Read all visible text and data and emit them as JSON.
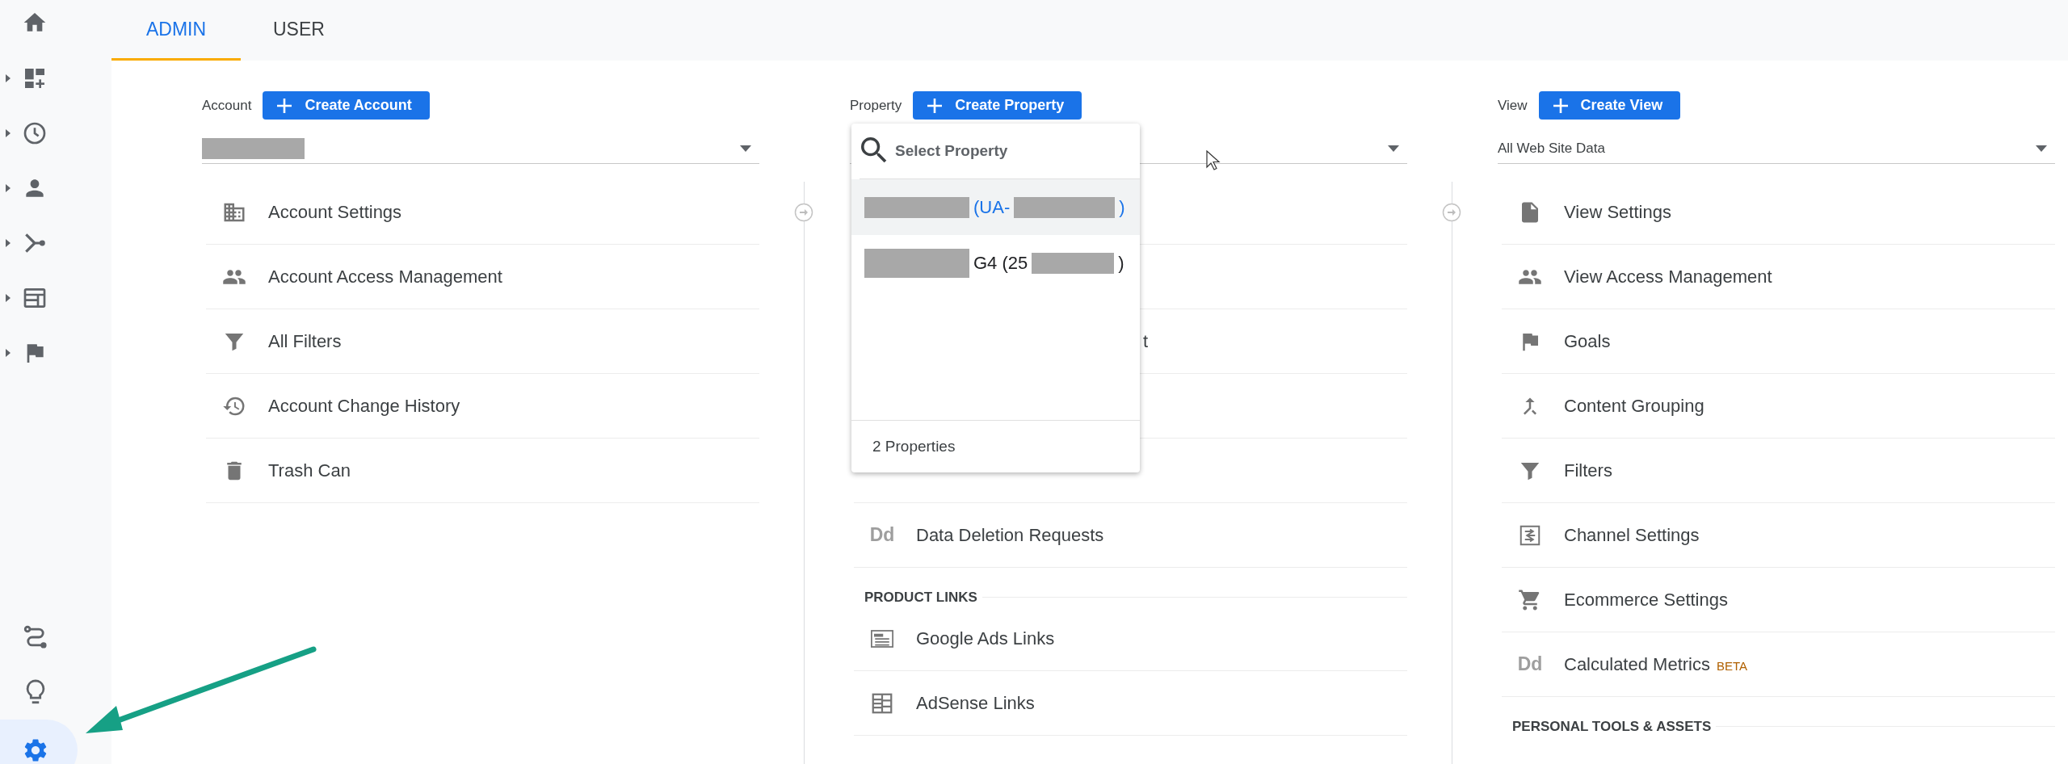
{
  "sidebar": {
    "items": [
      {
        "kind": "home",
        "expandable": false,
        "selected": false
      },
      {
        "kind": "dashboard",
        "expandable": true,
        "selected": false
      },
      {
        "kind": "clock",
        "expandable": true,
        "selected": false
      },
      {
        "kind": "person",
        "expandable": true,
        "selected": false
      },
      {
        "kind": "acquisition",
        "expandable": true,
        "selected": false
      },
      {
        "kind": "behavior",
        "expandable": true,
        "selected": false
      },
      {
        "kind": "flag",
        "expandable": true,
        "selected": false
      }
    ],
    "bottom_items": [
      {
        "kind": "route",
        "selected": false
      },
      {
        "kind": "bulb",
        "selected": false
      },
      {
        "kind": "gear",
        "selected": true
      }
    ]
  },
  "tabs": [
    {
      "label": "ADMIN",
      "selected": true
    },
    {
      "label": "USER",
      "selected": false
    }
  ],
  "columns": [
    {
      "label": "Account",
      "button": "Create Account",
      "selector": {
        "redacted": true
      },
      "items": [
        {
          "kind": "building",
          "label": "Account Settings"
        },
        {
          "kind": "people",
          "label": "Account Access Management"
        },
        {
          "kind": "filter",
          "label": "All Filters"
        },
        {
          "kind": "history",
          "label": "Account Change History"
        },
        {
          "kind": "trash",
          "label": "Trash Can"
        }
      ]
    },
    {
      "label": "Property",
      "button": "Create Property",
      "selector": {
        "redacted": false
      },
      "dropdown": {
        "placeholder": "Select Property",
        "footer": "2 Properties",
        "options": [
          {
            "selected": true,
            "parts": [
              {
                "kind": "redacted"
              },
              {
                "kind": "text",
                "text": "(UA-"
              },
              {
                "kind": "redacted"
              },
              {
                "kind": "text",
                "text": ")"
              }
            ]
          },
          {
            "selected": false,
            "parts": [
              {
                "kind": "redacted"
              },
              {
                "kind": "text",
                "text": "G4 (25"
              },
              {
                "kind": "redacted"
              },
              {
                "kind": "text",
                "text": ")"
              }
            ]
          }
        ]
      },
      "items": [
        {
          "kind": "covered"
        },
        {
          "kind": "covered"
        },
        {
          "kind": "covered",
          "fragment": "t"
        },
        {
          "kind": "covered"
        },
        {
          "kind": "covered"
        },
        {
          "kind": "letters",
          "icon_text": "Dd",
          "label": "Data Deletion Requests"
        }
      ],
      "section": {
        "title": "PRODUCT LINKS",
        "items": [
          {
            "kind": "ads",
            "label": "Google Ads Links"
          },
          {
            "kind": "adsense",
            "label": "AdSense Links"
          }
        ]
      }
    },
    {
      "label": "View",
      "button": "Create View",
      "selector": {
        "redacted": false,
        "value": "All Web Site Data"
      },
      "items": [
        {
          "kind": "doc",
          "label": "View Settings"
        },
        {
          "kind": "people",
          "label": "View Access Management"
        },
        {
          "kind": "flag",
          "label": "Goals"
        },
        {
          "kind": "merge",
          "label": "Content Grouping"
        },
        {
          "kind": "filter",
          "label": "Filters"
        },
        {
          "kind": "channel",
          "label": "Channel Settings"
        },
        {
          "kind": "cart",
          "label": "Ecommerce Settings"
        },
        {
          "kind": "letters",
          "icon_text": "Dd",
          "label": "Calculated Metrics",
          "badge": "BETA"
        }
      ],
      "section": {
        "title": "PERSONAL TOOLS & ASSETS"
      }
    }
  ]
}
